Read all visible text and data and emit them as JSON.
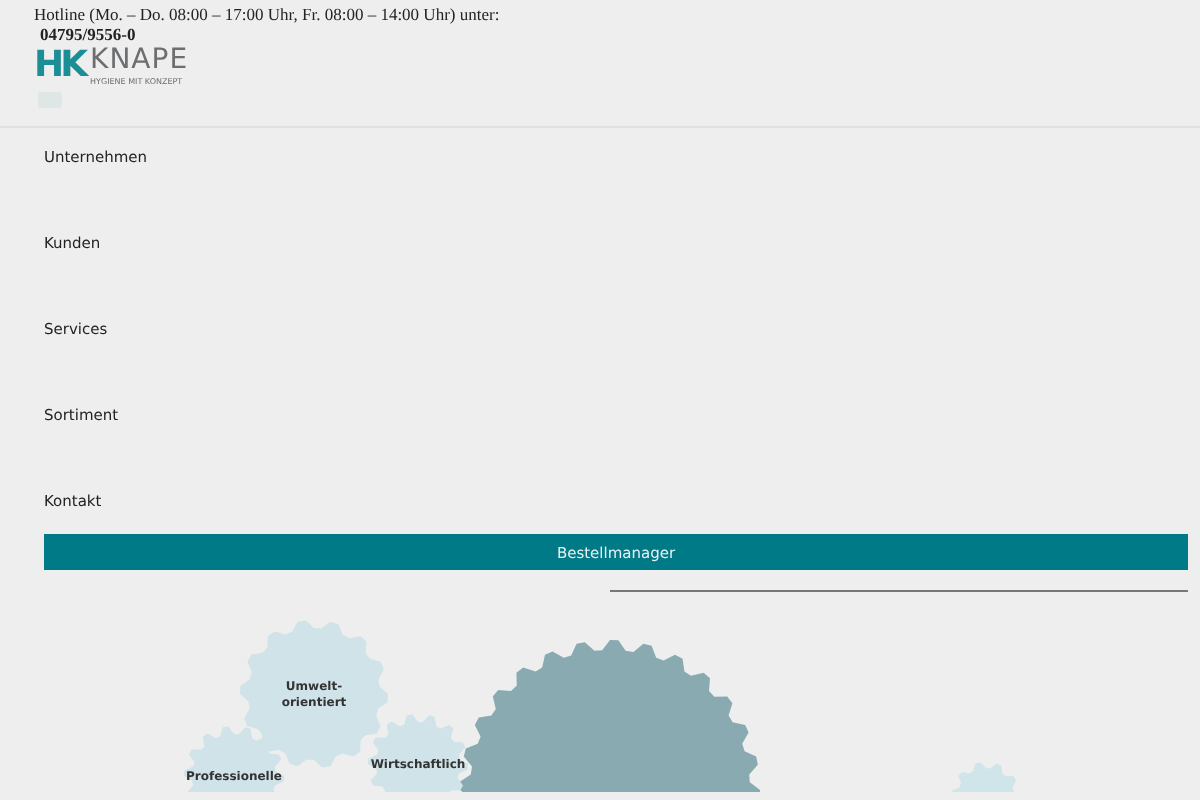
{
  "topbar": {
    "hotline": "Hotline (Mo. – Do. 08:00 – 17:00 Uhr, Fr. 08:00 – 14:00 Uhr) unter:",
    "phone": "04795/9556-0"
  },
  "logo": {
    "mark": "HK",
    "name": "KNAPE",
    "tagline": "HYGIENE MIT KONZEPT"
  },
  "nav": [
    {
      "label": "Unternehmen"
    },
    {
      "label": "Kunden"
    },
    {
      "label": "Services"
    },
    {
      "label": "Sortiment"
    },
    {
      "label": "Kontakt"
    }
  ],
  "cta": {
    "label": "Bestellmanager"
  },
  "gears": [
    {
      "label": "Umwelt-\norientiert"
    },
    {
      "label": "Wirtschaftlich"
    },
    {
      "label": "Professionelle"
    }
  ]
}
